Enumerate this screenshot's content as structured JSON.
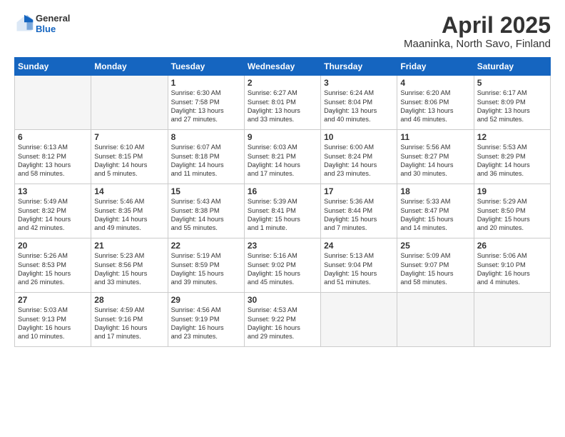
{
  "logo": {
    "general": "General",
    "blue": "Blue"
  },
  "title": "April 2025",
  "location": "Maaninka, North Savo, Finland",
  "days_of_week": [
    "Sunday",
    "Monday",
    "Tuesday",
    "Wednesday",
    "Thursday",
    "Friday",
    "Saturday"
  ],
  "weeks": [
    [
      {
        "day": "",
        "info": ""
      },
      {
        "day": "",
        "info": ""
      },
      {
        "day": "1",
        "info": "Sunrise: 6:30 AM\nSunset: 7:58 PM\nDaylight: 13 hours\nand 27 minutes."
      },
      {
        "day": "2",
        "info": "Sunrise: 6:27 AM\nSunset: 8:01 PM\nDaylight: 13 hours\nand 33 minutes."
      },
      {
        "day": "3",
        "info": "Sunrise: 6:24 AM\nSunset: 8:04 PM\nDaylight: 13 hours\nand 40 minutes."
      },
      {
        "day": "4",
        "info": "Sunrise: 6:20 AM\nSunset: 8:06 PM\nDaylight: 13 hours\nand 46 minutes."
      },
      {
        "day": "5",
        "info": "Sunrise: 6:17 AM\nSunset: 8:09 PM\nDaylight: 13 hours\nand 52 minutes."
      }
    ],
    [
      {
        "day": "6",
        "info": "Sunrise: 6:13 AM\nSunset: 8:12 PM\nDaylight: 13 hours\nand 58 minutes."
      },
      {
        "day": "7",
        "info": "Sunrise: 6:10 AM\nSunset: 8:15 PM\nDaylight: 14 hours\nand 5 minutes."
      },
      {
        "day": "8",
        "info": "Sunrise: 6:07 AM\nSunset: 8:18 PM\nDaylight: 14 hours\nand 11 minutes."
      },
      {
        "day": "9",
        "info": "Sunrise: 6:03 AM\nSunset: 8:21 PM\nDaylight: 14 hours\nand 17 minutes."
      },
      {
        "day": "10",
        "info": "Sunrise: 6:00 AM\nSunset: 8:24 PM\nDaylight: 14 hours\nand 23 minutes."
      },
      {
        "day": "11",
        "info": "Sunrise: 5:56 AM\nSunset: 8:27 PM\nDaylight: 14 hours\nand 30 minutes."
      },
      {
        "day": "12",
        "info": "Sunrise: 5:53 AM\nSunset: 8:29 PM\nDaylight: 14 hours\nand 36 minutes."
      }
    ],
    [
      {
        "day": "13",
        "info": "Sunrise: 5:49 AM\nSunset: 8:32 PM\nDaylight: 14 hours\nand 42 minutes."
      },
      {
        "day": "14",
        "info": "Sunrise: 5:46 AM\nSunset: 8:35 PM\nDaylight: 14 hours\nand 49 minutes."
      },
      {
        "day": "15",
        "info": "Sunrise: 5:43 AM\nSunset: 8:38 PM\nDaylight: 14 hours\nand 55 minutes."
      },
      {
        "day": "16",
        "info": "Sunrise: 5:39 AM\nSunset: 8:41 PM\nDaylight: 15 hours\nand 1 minute."
      },
      {
        "day": "17",
        "info": "Sunrise: 5:36 AM\nSunset: 8:44 PM\nDaylight: 15 hours\nand 7 minutes."
      },
      {
        "day": "18",
        "info": "Sunrise: 5:33 AM\nSunset: 8:47 PM\nDaylight: 15 hours\nand 14 minutes."
      },
      {
        "day": "19",
        "info": "Sunrise: 5:29 AM\nSunset: 8:50 PM\nDaylight: 15 hours\nand 20 minutes."
      }
    ],
    [
      {
        "day": "20",
        "info": "Sunrise: 5:26 AM\nSunset: 8:53 PM\nDaylight: 15 hours\nand 26 minutes."
      },
      {
        "day": "21",
        "info": "Sunrise: 5:23 AM\nSunset: 8:56 PM\nDaylight: 15 hours\nand 33 minutes."
      },
      {
        "day": "22",
        "info": "Sunrise: 5:19 AM\nSunset: 8:59 PM\nDaylight: 15 hours\nand 39 minutes."
      },
      {
        "day": "23",
        "info": "Sunrise: 5:16 AM\nSunset: 9:02 PM\nDaylight: 15 hours\nand 45 minutes."
      },
      {
        "day": "24",
        "info": "Sunrise: 5:13 AM\nSunset: 9:04 PM\nDaylight: 15 hours\nand 51 minutes."
      },
      {
        "day": "25",
        "info": "Sunrise: 5:09 AM\nSunset: 9:07 PM\nDaylight: 15 hours\nand 58 minutes."
      },
      {
        "day": "26",
        "info": "Sunrise: 5:06 AM\nSunset: 9:10 PM\nDaylight: 16 hours\nand 4 minutes."
      }
    ],
    [
      {
        "day": "27",
        "info": "Sunrise: 5:03 AM\nSunset: 9:13 PM\nDaylight: 16 hours\nand 10 minutes."
      },
      {
        "day": "28",
        "info": "Sunrise: 4:59 AM\nSunset: 9:16 PM\nDaylight: 16 hours\nand 17 minutes."
      },
      {
        "day": "29",
        "info": "Sunrise: 4:56 AM\nSunset: 9:19 PM\nDaylight: 16 hours\nand 23 minutes."
      },
      {
        "day": "30",
        "info": "Sunrise: 4:53 AM\nSunset: 9:22 PM\nDaylight: 16 hours\nand 29 minutes."
      },
      {
        "day": "",
        "info": ""
      },
      {
        "day": "",
        "info": ""
      },
      {
        "day": "",
        "info": ""
      }
    ]
  ]
}
